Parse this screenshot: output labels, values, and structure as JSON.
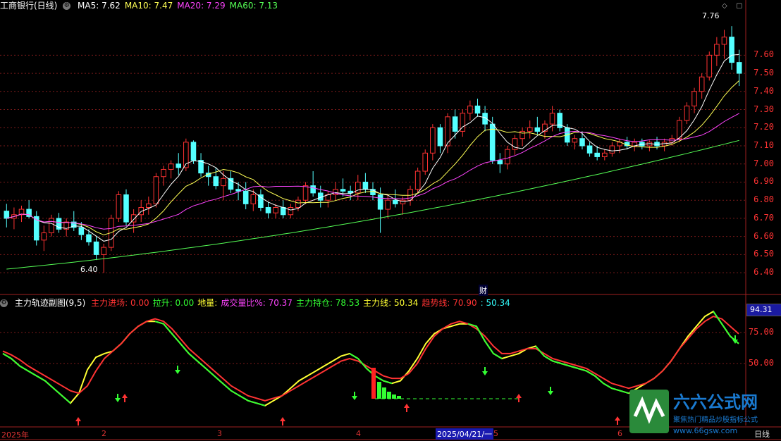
{
  "main_panel": {
    "stock_name": "工商银行(日线)",
    "ma": [
      {
        "label": "MA5: 7.62",
        "color": "#ffffff"
      },
      {
        "label": "MA10: 7.47",
        "color": "#ffff55"
      },
      {
        "label": "MA20: 7.29",
        "color": "#ff44ff"
      },
      {
        "label": "MA60: 7.13",
        "color": "#55ff55"
      }
    ],
    "y_ticks": [
      "7.60",
      "7.50",
      "7.40",
      "7.30",
      "7.20",
      "7.10",
      "7.00",
      "6.90",
      "6.80",
      "6.70",
      "6.60",
      "6.50",
      "6.40"
    ],
    "high_marker": "7.76",
    "low_marker": "6.40",
    "event_marker": "财"
  },
  "sub_panel": {
    "title": "主力轨迹副图(9,5)",
    "indicators": [
      {
        "label": "主力进场: 0.00",
        "color": "#ff3333"
      },
      {
        "label": "拉升: 0.00",
        "color": "#33ff33"
      },
      {
        "label": "地量:",
        "color": "#ffff33"
      },
      {
        "label": "成交量比%: 70.37",
        "color": "#ff44ff"
      },
      {
        "label": "主力持仓: 78.53",
        "color": "#33ff33"
      },
      {
        "label": "主力线: 50.34",
        "color": "#ffff33"
      },
      {
        "label": "趋势线: 70.90",
        "color": "#ff3333"
      },
      {
        "label": ": 50.34",
        "color": "#33ffff"
      }
    ],
    "y_ticks": [
      "75.00",
      "50.00"
    ],
    "current_value": "94.31"
  },
  "x_axis": {
    "labels": [
      "2025年",
      "2",
      "3",
      "4",
      "5",
      "6"
    ],
    "cursor_date": "2025/04/21/一",
    "period": "日线"
  },
  "watermark": {
    "title": "六六公式网",
    "subtitle": "聚焦热门精品炒股指标公式",
    "url": "www.66gsw.com"
  },
  "colors": {
    "up": "#ff3232",
    "down": "#54ffff",
    "grid": "#7a1a1a",
    "axis_text": "#ff3333"
  },
  "chart_data": {
    "type": "candlestick",
    "title": "工商银行(日线)",
    "ylim": [
      6.35,
      7.85
    ],
    "candles": [
      [
        6.74,
        6.78,
        6.65,
        6.7
      ],
      [
        6.7,
        6.76,
        6.64,
        6.72
      ],
      [
        6.72,
        6.77,
        6.68,
        6.75
      ],
      [
        6.75,
        6.8,
        6.7,
        6.71
      ],
      [
        6.71,
        6.74,
        6.55,
        6.58
      ],
      [
        6.58,
        6.66,
        6.52,
        6.62
      ],
      [
        6.62,
        6.72,
        6.6,
        6.7
      ],
      [
        6.7,
        6.73,
        6.62,
        6.64
      ],
      [
        6.64,
        6.7,
        6.6,
        6.68
      ],
      [
        6.68,
        6.74,
        6.63,
        6.65
      ],
      [
        6.65,
        6.68,
        6.58,
        6.61
      ],
      [
        6.61,
        6.64,
        6.55,
        6.57
      ],
      [
        6.57,
        6.6,
        6.47,
        6.5
      ],
      [
        6.5,
        6.56,
        6.4,
        6.54
      ],
      [
        6.54,
        6.72,
        6.52,
        6.7
      ],
      [
        6.7,
        6.85,
        6.68,
        6.83
      ],
      [
        6.83,
        6.86,
        6.66,
        6.68
      ],
      [
        6.68,
        6.75,
        6.62,
        6.72
      ],
      [
        6.72,
        6.8,
        6.68,
        6.76
      ],
      [
        6.76,
        6.82,
        6.72,
        6.78
      ],
      [
        6.78,
        6.95,
        6.76,
        6.93
      ],
      [
        6.93,
        6.99,
        6.88,
        6.97
      ],
      [
        6.97,
        7.02,
        6.92,
        7.0
      ],
      [
        7.0,
        7.06,
        6.94,
        6.98
      ],
      [
        6.98,
        7.14,
        6.96,
        7.12
      ],
      [
        7.12,
        7.13,
        7.0,
        7.02
      ],
      [
        7.02,
        7.06,
        6.93,
        6.95
      ],
      [
        6.95,
        6.99,
        6.88,
        6.93
      ],
      [
        6.93,
        6.98,
        6.86,
        6.88
      ],
      [
        6.88,
        6.96,
        6.8,
        6.92
      ],
      [
        6.92,
        6.96,
        6.84,
        6.86
      ],
      [
        6.86,
        6.9,
        6.8,
        6.85
      ],
      [
        6.85,
        6.9,
        6.75,
        6.78
      ],
      [
        6.78,
        6.86,
        6.74,
        6.83
      ],
      [
        6.83,
        6.86,
        6.74,
        6.76
      ],
      [
        6.76,
        6.79,
        6.7,
        6.73
      ],
      [
        6.73,
        6.78,
        6.7,
        6.76
      ],
      [
        6.76,
        6.8,
        6.7,
        6.72
      ],
      [
        6.72,
        6.78,
        6.7,
        6.76
      ],
      [
        6.76,
        6.82,
        6.74,
        6.8
      ],
      [
        6.8,
        6.9,
        6.78,
        6.88
      ],
      [
        6.88,
        6.96,
        6.82,
        6.84
      ],
      [
        6.84,
        6.88,
        6.76,
        6.8
      ],
      [
        6.8,
        6.85,
        6.76,
        6.83
      ],
      [
        6.83,
        6.9,
        6.8,
        6.86
      ],
      [
        6.86,
        6.92,
        6.82,
        6.85
      ],
      [
        6.85,
        6.88,
        6.8,
        6.84
      ],
      [
        6.84,
        6.94,
        6.8,
        6.9
      ],
      [
        6.9,
        6.95,
        6.84,
        6.86
      ],
      [
        6.86,
        6.9,
        6.8,
        6.83
      ],
      [
        6.83,
        6.87,
        6.62,
        6.75
      ],
      [
        6.75,
        6.83,
        6.7,
        6.8
      ],
      [
        6.8,
        6.86,
        6.76,
        6.78
      ],
      [
        6.78,
        6.82,
        6.72,
        6.8
      ],
      [
        6.8,
        6.88,
        6.77,
        6.86
      ],
      [
        6.86,
        6.98,
        6.84,
        6.96
      ],
      [
        6.96,
        7.08,
        6.94,
        7.06
      ],
      [
        7.06,
        7.22,
        7.02,
        7.2
      ],
      [
        7.2,
        7.22,
        7.06,
        7.1
      ],
      [
        7.1,
        7.28,
        7.06,
        7.26
      ],
      [
        7.26,
        7.3,
        7.14,
        7.18
      ],
      [
        7.18,
        7.3,
        7.15,
        7.28
      ],
      [
        7.28,
        7.35,
        7.24,
        7.32
      ],
      [
        7.32,
        7.36,
        7.26,
        7.28
      ],
      [
        7.28,
        7.32,
        7.18,
        7.22
      ],
      [
        7.22,
        7.26,
        7.0,
        7.02
      ],
      [
        7.02,
        7.06,
        6.95,
        7.0
      ],
      [
        7.0,
        7.1,
        6.97,
        7.08
      ],
      [
        7.08,
        7.16,
        7.05,
        7.14
      ],
      [
        7.14,
        7.2,
        7.1,
        7.18
      ],
      [
        7.18,
        7.24,
        7.14,
        7.2
      ],
      [
        7.2,
        7.26,
        7.16,
        7.18
      ],
      [
        7.18,
        7.24,
        7.14,
        7.22
      ],
      [
        7.22,
        7.32,
        7.18,
        7.28
      ],
      [
        7.28,
        7.3,
        7.18,
        7.2
      ],
      [
        7.2,
        7.22,
        7.1,
        7.12
      ],
      [
        7.12,
        7.16,
        7.08,
        7.14
      ],
      [
        7.14,
        7.18,
        7.08,
        7.1
      ],
      [
        7.1,
        7.12,
        7.04,
        7.06
      ],
      [
        7.06,
        7.1,
        7.02,
        7.04
      ],
      [
        7.04,
        7.08,
        7.02,
        7.06
      ],
      [
        7.06,
        7.12,
        7.04,
        7.1
      ],
      [
        7.1,
        7.14,
        7.06,
        7.12
      ],
      [
        7.12,
        7.15,
        7.08,
        7.1
      ],
      [
        7.1,
        7.14,
        7.07,
        7.12
      ],
      [
        7.12,
        7.14,
        7.08,
        7.1
      ],
      [
        7.1,
        7.13,
        7.07,
        7.12
      ],
      [
        7.12,
        7.15,
        7.08,
        7.1
      ],
      [
        7.1,
        7.14,
        7.07,
        7.12
      ],
      [
        7.12,
        7.16,
        7.1,
        7.14
      ],
      [
        7.14,
        7.26,
        7.12,
        7.24
      ],
      [
        7.24,
        7.34,
        7.22,
        7.32
      ],
      [
        7.32,
        7.42,
        7.28,
        7.4
      ],
      [
        7.4,
        7.5,
        7.36,
        7.48
      ],
      [
        7.48,
        7.62,
        7.46,
        7.6
      ],
      [
        7.6,
        7.7,
        7.54,
        7.66
      ],
      [
        7.66,
        7.74,
        7.58,
        7.7
      ],
      [
        7.7,
        7.76,
        7.52,
        7.56
      ],
      [
        7.56,
        7.63,
        7.43,
        7.5
      ]
    ],
    "ma_series": [
      {
        "name": "MA5",
        "color": "#ffffff",
        "period": 5
      },
      {
        "name": "MA10",
        "color": "#ffff55",
        "period": 10
      },
      {
        "name": "MA20",
        "color": "#ff44ff",
        "period": 20
      },
      {
        "name": "MA60",
        "color": "#55ff55",
        "values_start": 6.42,
        "values_end": 7.13
      }
    ],
    "sub_series": [
      {
        "name": "主力线",
        "color": "#ffff33",
        "values": [
          58,
          54,
          48,
          44,
          40,
          36,
          30,
          24,
          18,
          26,
          45,
          55,
          58,
          60,
          66,
          74,
          80,
          84,
          84,
          82,
          74,
          66,
          58,
          52,
          46,
          40,
          34,
          28,
          24,
          20,
          18,
          16,
          20,
          24,
          30,
          36,
          40,
          44,
          48,
          52,
          56,
          58,
          54,
          46,
          40,
          36,
          34,
          36,
          44,
          54,
          66,
          74,
          78,
          80,
          82,
          82,
          80,
          68,
          58,
          54,
          56,
          58,
          62,
          64,
          56,
          52,
          50,
          48,
          46,
          44,
          40,
          34,
          30,
          28,
          26,
          30,
          34,
          38,
          44,
          52,
          62,
          72,
          80,
          88,
          92,
          82,
          72,
          66
        ]
      },
      {
        "name": "趋势线",
        "color": "#ff3333",
        "values": [
          60,
          57,
          53,
          48,
          44,
          40,
          36,
          32,
          28,
          26,
          32,
          44,
          54,
          60,
          66,
          74,
          80,
          84,
          86,
          84,
          78,
          70,
          62,
          56,
          50,
          44,
          38,
          32,
          28,
          24,
          22,
          20,
          22,
          24,
          28,
          32,
          36,
          40,
          44,
          48,
          52,
          54,
          52,
          48,
          44,
          40,
          38,
          38,
          42,
          50,
          62,
          72,
          78,
          82,
          84,
          82,
          78,
          72,
          64,
          58,
          58,
          60,
          62,
          62,
          58,
          54,
          52,
          50,
          48,
          46,
          42,
          38,
          34,
          32,
          30,
          32,
          34,
          38,
          44,
          52,
          62,
          70,
          78,
          84,
          88,
          86,
          80,
          74
        ]
      }
    ]
  }
}
